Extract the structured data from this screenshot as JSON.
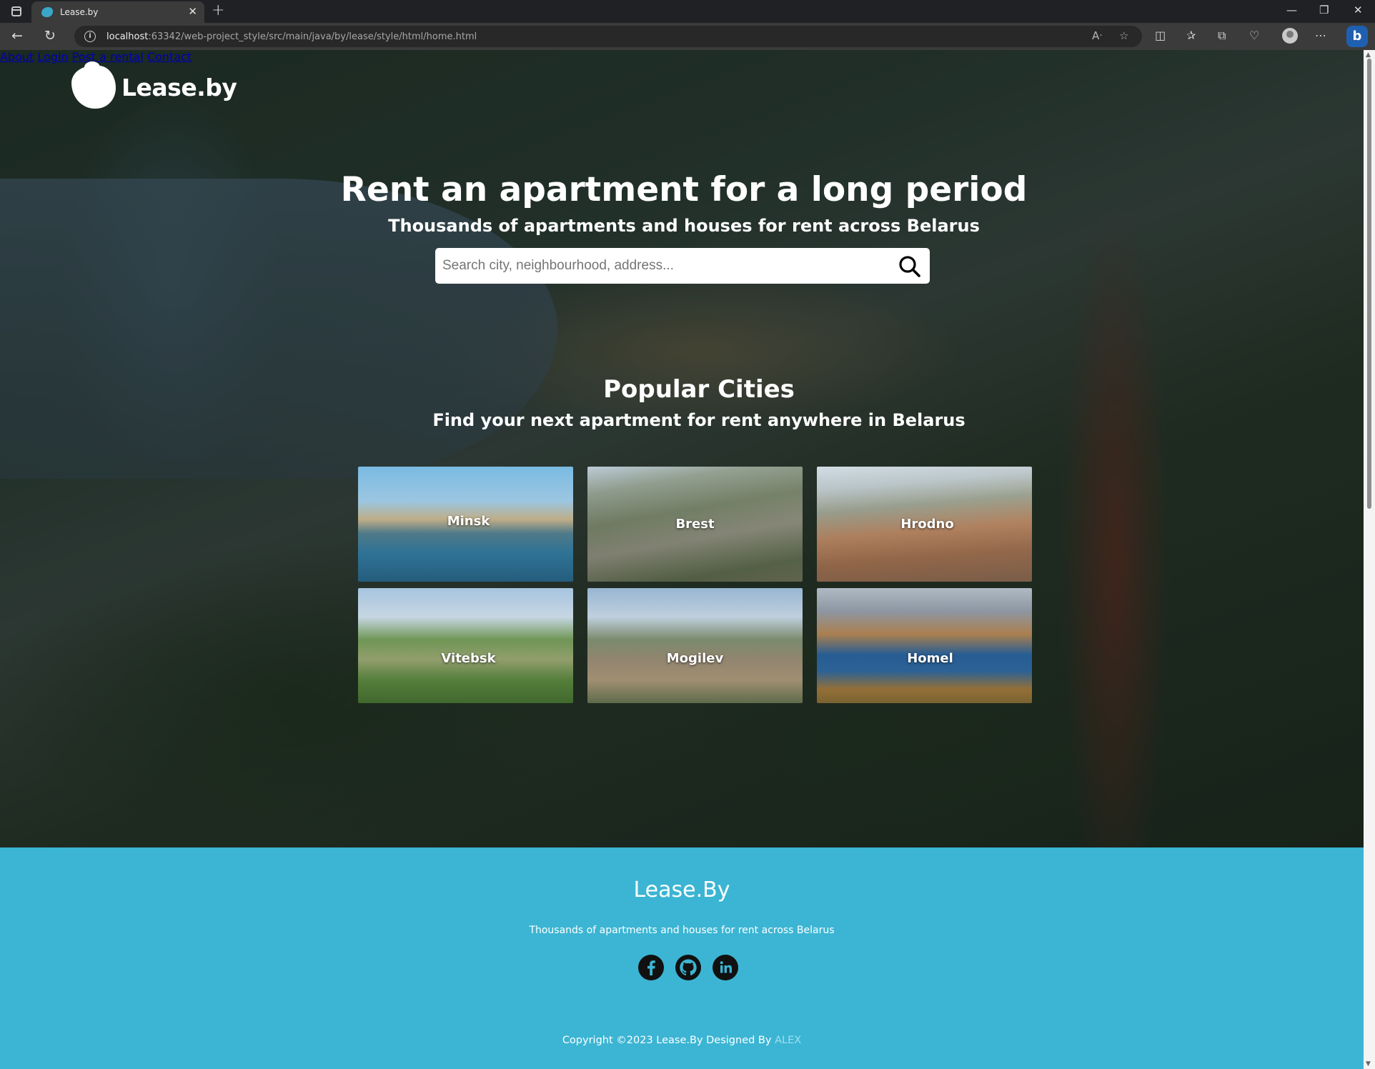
{
  "browser": {
    "tab_title": "Lease.by",
    "url_host": "localhost",
    "url_rest": ":63342/web-project_style/src/main/java/by/lease/style/html/home.html"
  },
  "header": {
    "logo_text": "Lease.by",
    "nav": [
      "About",
      "Login",
      "Post a rental",
      "Contact"
    ]
  },
  "hero": {
    "title": "Rent an apartment for a long period",
    "subtitle": "Thousands of apartments and houses for rent across Belarus",
    "search_placeholder": "Search city, neighbourhood, address..."
  },
  "popular": {
    "title": "Popular Cities",
    "subtitle": "Find your next apartment for rent anywhere in Belarus",
    "cities": [
      "Minsk",
      "Brest",
      "Hrodno",
      "Vitebsk",
      "Mogilev",
      "Homel"
    ]
  },
  "footer": {
    "brand": "Lease.By",
    "tagline": "Thousands of apartments and houses for rent across Belarus",
    "social": [
      "facebook-icon",
      "github-icon",
      "linkedin-icon"
    ],
    "copyright": "Copyright ©2023 Lease.By Designed By",
    "author": "ALEX",
    "background_color": "#3bb5d3"
  }
}
